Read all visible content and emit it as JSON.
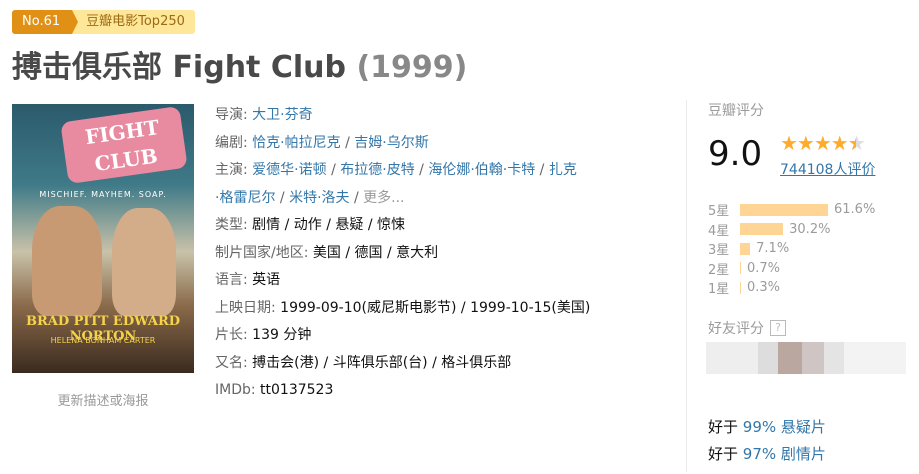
{
  "badge": {
    "rank": "No.61",
    "label": "豆瓣电影Top250"
  },
  "title": {
    "name": "搏击俱乐部 Fight Club",
    "year": "(1999)"
  },
  "poster": {
    "soap_text": "FIGHT CLUB",
    "tagline": "MISCHIEF. MAYHEM. SOAP.",
    "names": "BRAD PITT  EDWARD NORTON",
    "sub": "HELENA BONHAM CARTER",
    "update_link": "更新描述或海报"
  },
  "info": {
    "director_label": "导演: ",
    "director": "大卫·芬奇",
    "writer_label": "编剧: ",
    "writers": [
      "恰克·帕拉尼克",
      "吉姆·乌尔斯"
    ],
    "cast_label": "主演: ",
    "cast": [
      "爱德华·诺顿",
      "布拉德·皮特",
      "海伦娜·伯翰·卡特",
      "扎克"
    ],
    "cast_line2": [
      "·格雷尼尔",
      "米特·洛夫"
    ],
    "more": "更多...",
    "genre_label": "类型: ",
    "genre": "剧情 / 动作 / 悬疑 / 惊悚",
    "country_label": "制片国家/地区: ",
    "country": "美国 / 德国 / 意大利",
    "language_label": "语言: ",
    "language": "英语",
    "release_label": "上映日期: ",
    "release": "1999-09-10(威尼斯电影节) / 1999-10-15(美国)",
    "runtime_label": "片长: ",
    "runtime": "139 分钟",
    "aka_label": "又名: ",
    "aka": "搏击会(港) / 斗阵俱乐部(台) / 格斗俱乐部",
    "imdb_label": "IMDb: ",
    "imdb": "tt0137523"
  },
  "rating": {
    "title": "豆瓣评分",
    "score": "9.0",
    "stars": 4.5,
    "votes": "744108人评价",
    "distribution": [
      {
        "label": "5星",
        "percent": 61.6,
        "text": "61.6%"
      },
      {
        "label": "4星",
        "percent": 30.2,
        "text": "30.2%"
      },
      {
        "label": "3星",
        "percent": 7.1,
        "text": "7.1%"
      },
      {
        "label": "2星",
        "percent": 0.7,
        "text": "0.7%"
      },
      {
        "label": "1星",
        "percent": 0.3,
        "text": "0.3%"
      }
    ]
  },
  "friends": {
    "title": "好友评分",
    "help": "?"
  },
  "better_than": [
    {
      "prefix": "好于 ",
      "text": "99% 悬疑片"
    },
    {
      "prefix": "好于 ",
      "text": "97% 剧情片"
    }
  ],
  "colors": {
    "link": "#3377aa",
    "star": "#ffac2d",
    "bar": "#ffd596",
    "badge": "#e09015"
  }
}
